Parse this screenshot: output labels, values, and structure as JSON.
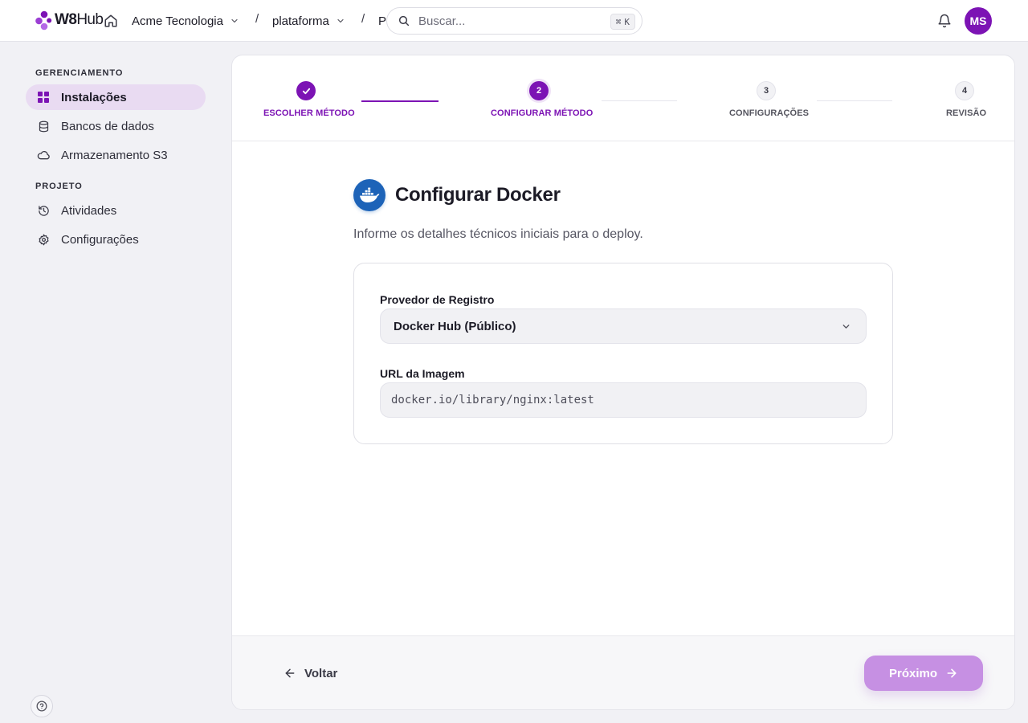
{
  "header": {
    "logo_text_bold": "W8",
    "logo_text_light": "Hub",
    "breadcrumbs": [
      {
        "label": "Acme Tecnologia",
        "has_dropdown": true
      },
      {
        "label": "plataforma",
        "has_dropdown": true
      },
      {
        "label": "P",
        "has_dropdown": false
      }
    ],
    "separator": "/",
    "search": {
      "placeholder": "Buscar...",
      "shortcut_symbol": "⌘",
      "shortcut_key": "K"
    },
    "avatar_initials": "MS"
  },
  "sidebar": {
    "sections": [
      {
        "title": "GERENCIAMENTO",
        "items": [
          {
            "label": "Instalações",
            "icon": "grid-icon",
            "active": true
          },
          {
            "label": "Bancos de dados",
            "icon": "database-icon",
            "active": false
          },
          {
            "label": "Armazenamento S3",
            "icon": "cloud-icon",
            "active": false
          }
        ]
      },
      {
        "title": "PROJETO",
        "items": [
          {
            "label": "Atividades",
            "icon": "history-icon",
            "active": false
          },
          {
            "label": "Configurações",
            "icon": "gear-icon",
            "active": false
          }
        ]
      }
    ],
    "help_icon": "help-circle-icon"
  },
  "stepper": {
    "steps": [
      {
        "number": "1",
        "label": "ESCOLHER MÉTODO",
        "state": "done"
      },
      {
        "number": "2",
        "label": "CONFIGURAR MÉTODO",
        "state": "current"
      },
      {
        "number": "3",
        "label": "CONFIGURAÇÕES",
        "state": "todo"
      },
      {
        "number": "4",
        "label": "REVISÃO",
        "state": "todo"
      }
    ]
  },
  "main": {
    "icon": "docker-icon",
    "title": "Configurar Docker",
    "subtitle": "Informe os detalhes técnicos iniciais para o deploy.",
    "form": {
      "registry_label": "Provedor de Registro",
      "registry_value": "Docker Hub (Público)",
      "image_label": "URL da Imagem",
      "image_placeholder": "docker.io/library/nginx:latest",
      "image_value": ""
    }
  },
  "footer": {
    "back_label": "Voltar",
    "next_label": "Próximo"
  },
  "colors": {
    "accent": "#7c13b4",
    "accent_light": "#c690e3",
    "active_nav_bg": "#e9dbf2",
    "docker_blue": "#1d63b8"
  }
}
